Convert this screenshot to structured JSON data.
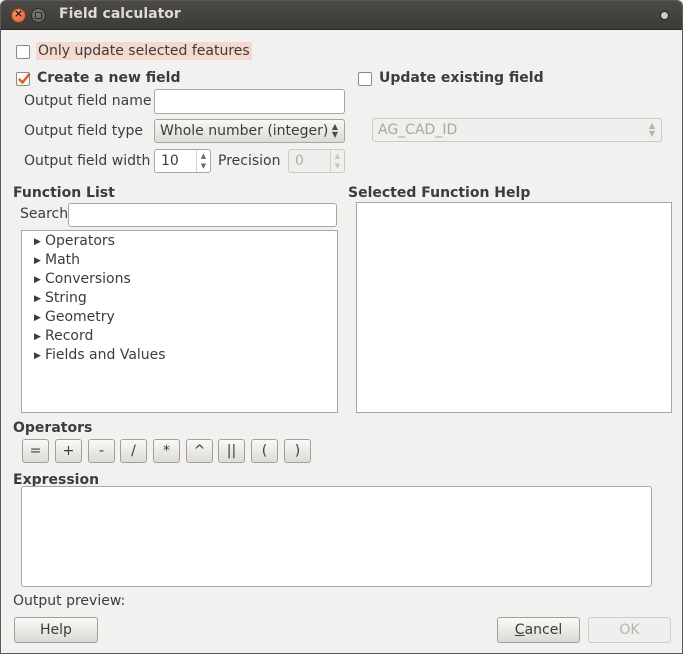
{
  "window": {
    "title": "Field calculator"
  },
  "only_update_selected": {
    "label": "Only update selected features",
    "checked": false
  },
  "create_new_field": {
    "label": "Create a new field",
    "checked": true
  },
  "update_existing_field": {
    "label": "Update existing field",
    "checked": false,
    "field_value": "AG_CAD_ID"
  },
  "output_field": {
    "name_label": "Output field name",
    "name_value": "",
    "type_label": "Output field type",
    "type_value": "Whole number (integer)",
    "width_label": "Output field width",
    "width_value": "10",
    "precision_label": "Precision",
    "precision_value": "0"
  },
  "function_list": {
    "heading": "Function List",
    "search_label": "Search",
    "search_value": "",
    "items": [
      "Operators",
      "Math",
      "Conversions",
      "String",
      "Geometry",
      "Record",
      "Fields and Values"
    ]
  },
  "function_help": {
    "heading": "Selected Function Help"
  },
  "operators": {
    "heading": "Operators",
    "buttons": [
      "=",
      "+",
      "-",
      "/",
      "*",
      "^",
      "||",
      "(",
      ")"
    ]
  },
  "expression": {
    "heading": "Expression",
    "value": ""
  },
  "output_preview": {
    "label": "Output preview:"
  },
  "buttons": {
    "help": "Help",
    "cancel_underlined": "C",
    "cancel_rest": "ancel",
    "ok": "OK"
  },
  "colors": {
    "accent": "#e0552b",
    "highlight": "#f4d9cf"
  }
}
